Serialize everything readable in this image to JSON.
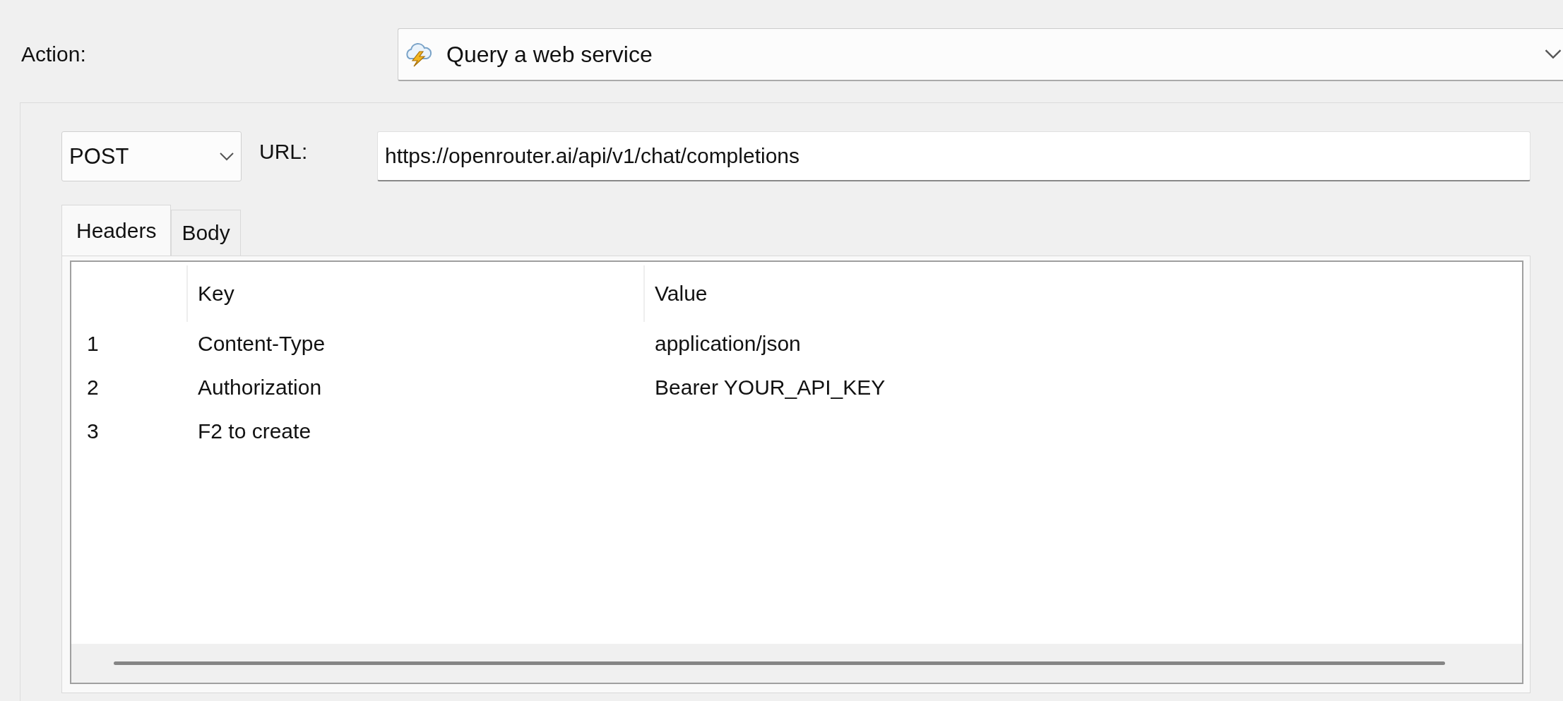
{
  "action": {
    "label": "Action:",
    "value": "Query a web service"
  },
  "request": {
    "method": "POST",
    "url_label": "URL:",
    "url": "https://openrouter.ai/api/v1/chat/completions"
  },
  "tabs": [
    {
      "label": "Headers",
      "selected": true
    },
    {
      "label": "Body",
      "selected": false
    }
  ],
  "table": {
    "columns": [
      "Key",
      "Value"
    ],
    "rows": [
      {
        "number": "1",
        "key": "Content-Type",
        "value": "application/json"
      },
      {
        "number": "2",
        "key": "Authorization",
        "value": "Bearer YOUR_API_KEY"
      },
      {
        "number": "3",
        "key": "F2 to create"
      }
    ]
  }
}
